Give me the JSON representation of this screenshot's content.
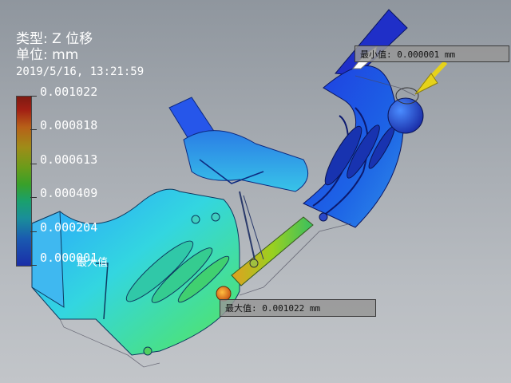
{
  "result": {
    "type_label": "类型: Z 位移",
    "unit_label": "单位: mm",
    "timestamp": "2019/5/16, 13:21:59"
  },
  "legend": {
    "values": [
      "0.001022",
      "0.000818",
      "0.000613",
      "0.000409",
      "0.000204",
      "0.000001"
    ],
    "min_badge": "最大值"
  },
  "probes": {
    "min": "最小值: 0.000001 mm",
    "max": "最大值: 0.001022 mm"
  },
  "colors": {
    "max": "#7f1a12",
    "min": "#1a2ea8",
    "background_top": "#8f969e",
    "background_bottom": "#c2c5c9"
  },
  "icons": {
    "min_arrow": "yellow-arrow-icon",
    "max_marker": "orange-sphere-icon"
  }
}
